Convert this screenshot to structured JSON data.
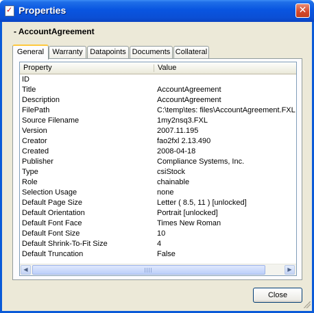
{
  "window": {
    "title": "Properties"
  },
  "heading": "- AccountAgreement",
  "tabs": [
    "General",
    "Warranty",
    "Datapoints",
    "Documents",
    "Collateral"
  ],
  "grid": {
    "columns": [
      "Property",
      "Value"
    ],
    "rows": [
      {
        "property": "ID",
        "value": ""
      },
      {
        "property": "Title",
        "value": "AccountAgreement"
      },
      {
        "property": "Description",
        "value": "AccountAgreement"
      },
      {
        "property": "FilePath",
        "value": "C:\\temp\\tes: files\\AccountAgreement.FXL"
      },
      {
        "property": "Source Filename",
        "value": "1my2nsq3.FXL"
      },
      {
        "property": "Version",
        "value": "2007.11.195"
      },
      {
        "property": "Creator",
        "value": "fao2fxl 2.13.490"
      },
      {
        "property": "Created",
        "value": "2008-04-18"
      },
      {
        "property": "Publisher",
        "value": "Compliance Systems, Inc."
      },
      {
        "property": "Type",
        "value": "csiStock"
      },
      {
        "property": "Role",
        "value": "chainable"
      },
      {
        "property": "Selection Usage",
        "value": "none"
      },
      {
        "property": "Default Page Size",
        "value": "Letter ( 8.5, 11 ) [unlocked]"
      },
      {
        "property": "Default Orientation",
        "value": "Portrait [unlocked]"
      },
      {
        "property": "Default Font Face",
        "value": "Times New Roman"
      },
      {
        "property": "Default Font Size",
        "value": "10"
      },
      {
        "property": "Default Shrink-To-Fit Size",
        "value": "4"
      },
      {
        "property": "Default Truncation",
        "value": "False"
      }
    ]
  },
  "buttons": {
    "close": "Close"
  },
  "icons": {
    "title": "properties-check-icon",
    "close": "close-x-icon",
    "scroll_left": "arrow-left-icon",
    "scroll_right": "arrow-right-icon"
  },
  "colors": {
    "titlebar": "#0955e0",
    "client": "#ece9d8",
    "active_tab_accent": "#ffc83c"
  }
}
